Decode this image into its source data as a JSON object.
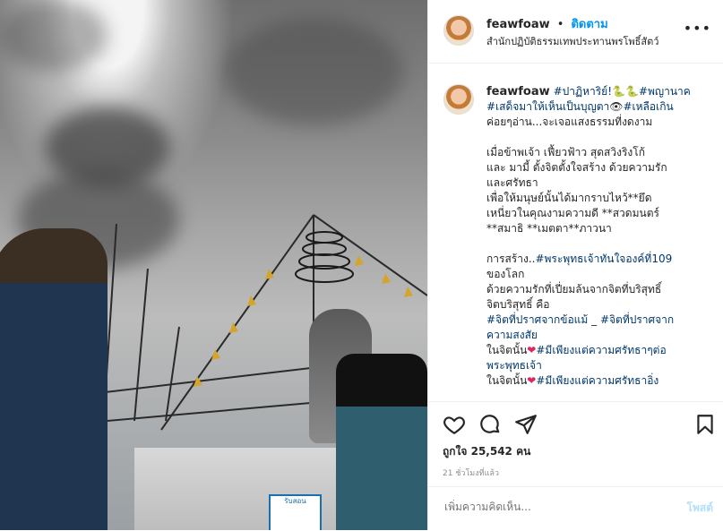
{
  "header": {
    "username": "feawfoaw",
    "separator": "•",
    "follow_label": "ติดตาม",
    "location": "สำนักปฏิบัติธรรมเทพประทานพรโพธิ์สัตว์",
    "more_icon": "more-horizontal-icon"
  },
  "photo": {
    "sign_text": "รับสอน"
  },
  "caption": {
    "username": "feawfoaw",
    "lines": [
      {
        "segs": [
          {
            "t": "#ปาฏิหาริย์!",
            "tag": true
          },
          {
            "t": "🐍🐍",
            "tag": false
          },
          {
            "t": "#พญานาค",
            "tag": true
          }
        ]
      },
      {
        "segs": [
          {
            "t": "#เสด็จมาให้เห็นเป็นบุญตา",
            "tag": true
          },
          {
            "t": "👁",
            "tag": false
          },
          {
            "t": "#เหลือเกิน",
            "tag": true
          }
        ]
      },
      {
        "segs": [
          {
            "t": "ค่อยๆอ่าน...จะเจอแสงธรรมที่งดงาม",
            "tag": false
          }
        ]
      },
      {
        "segs": [
          {
            "t": "",
            "tag": false
          }
        ]
      },
      {
        "segs": [
          {
            "t": "เมื่อข้าพเจ้า เฟี้ยวฟ้าว สุดสวิงริงโก้",
            "tag": false
          }
        ]
      },
      {
        "segs": [
          {
            "t": "และ มามี้ ตั้งจิตตั้งใจสร้าง ด้วยความรัก",
            "tag": false
          }
        ]
      },
      {
        "segs": [
          {
            "t": "และศรัทธา",
            "tag": false
          }
        ]
      },
      {
        "segs": [
          {
            "t": "เพื่อให้มนุษย์นั้นได้มากราบไหว้**ยึด",
            "tag": false
          }
        ]
      },
      {
        "segs": [
          {
            "t": "เหนี่ยวในคุณงามความดี **สวดมนตร์",
            "tag": false
          }
        ]
      },
      {
        "segs": [
          {
            "t": "**สมาธิ **เมตตา**ภาวนา",
            "tag": false
          }
        ]
      },
      {
        "segs": [
          {
            "t": "",
            "tag": false
          }
        ]
      },
      {
        "segs": [
          {
            "t": "การสร้าง..",
            "tag": false
          },
          {
            "t": "#พระพุทธเจ้าทันใจองค์ที่109",
            "tag": true
          }
        ]
      },
      {
        "segs": [
          {
            "t": "ของโลก",
            "tag": false
          }
        ]
      },
      {
        "segs": [
          {
            "t": "ด้วยความรักที่เปี่ยมล้นจากจิตที่บริสุทธิ์",
            "tag": false
          }
        ]
      },
      {
        "segs": [
          {
            "t": "จิตบริสุทธิ์ คือ",
            "tag": false
          }
        ]
      },
      {
        "segs": [
          {
            "t": "#จิตที่ปราศจากข้อแม้",
            "tag": true
          },
          {
            "t": " _ ",
            "tag": false
          },
          {
            "t": "#จิตที่ปราศจาก",
            "tag": true
          }
        ]
      },
      {
        "segs": [
          {
            "t": "ความสงสัย",
            "tag": true
          }
        ]
      },
      {
        "segs": [
          {
            "t": "ในจิตนั้น",
            "tag": false
          },
          {
            "t": "❤",
            "tag": false,
            "heart": true
          },
          {
            "t": "#มีเพียงแต่ความศรัทธาๆต่อ",
            "tag": true
          }
        ]
      },
      {
        "segs": [
          {
            "t": "พระพุทธเจ้า",
            "tag": true
          }
        ]
      },
      {
        "segs": [
          {
            "t": "ในจิตนั้น",
            "tag": false
          },
          {
            "t": "❤",
            "tag": false,
            "heart": true
          },
          {
            "t": "#มีเพียงแต่ความศรัทธาอิ่ง",
            "tag": true
          }
        ]
      }
    ]
  },
  "actions": {
    "like_icon": "heart-icon",
    "comment_icon": "comment-icon",
    "share_icon": "share-icon",
    "save_icon": "bookmark-icon",
    "likes_text": "ถูกใจ 25,542 คน",
    "time_text": "21 ชั่วโมงที่แล้ว"
  },
  "comment": {
    "placeholder": "เพิ่มความคิดเห็น...",
    "post_label": "โพสต์"
  },
  "colors": {
    "accent": "#0095f6",
    "hashtag": "#00376b",
    "post_disabled": "#b2dffc",
    "heart": "#e0245e"
  }
}
